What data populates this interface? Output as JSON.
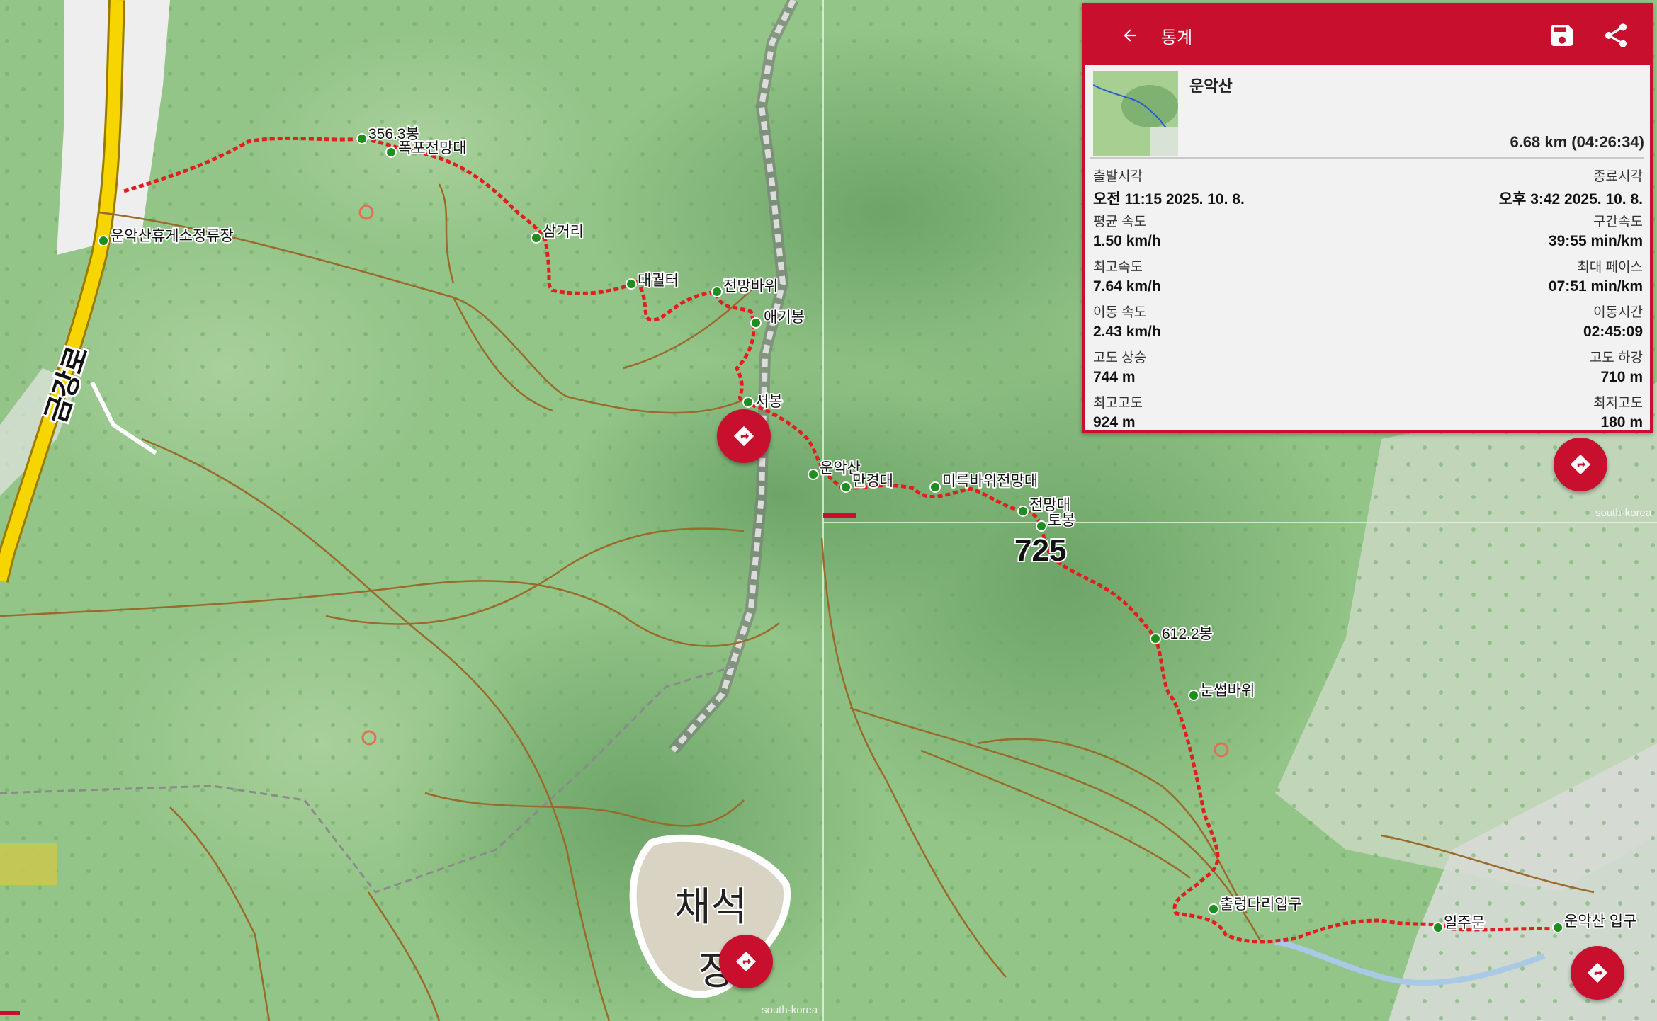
{
  "panel": {
    "title": "통계",
    "route_name": "운악산",
    "distance_time": "6.68 km (04:26:34)",
    "stats": [
      {
        "lk": "출발시각",
        "lv": "오전 11:15 2025. 10. 8.",
        "rk": "종료시각",
        "rv": "오후 3:42 2025. 10. 8."
      },
      {
        "lk": "평균 속도",
        "lv": "1.50 km/h",
        "rk": "구간속도",
        "rv": "39:55 min/km"
      },
      {
        "lk": "최고속도",
        "lv": "7.64 km/h",
        "rk": "최대 페이스",
        "rv": "07:51 min/km"
      },
      {
        "lk": "이동 속도",
        "lv": "2.43 km/h",
        "rk": "이동시간",
        "rv": "02:45:09"
      },
      {
        "lk": "고도 상승",
        "lv": "744 m",
        "rk": "고도 하강",
        "rv": "710 m"
      },
      {
        "lk": "최고고도",
        "lv": "924 m",
        "rk": "최저고도",
        "rv": "180 m"
      }
    ]
  },
  "map": {
    "waypoints": {
      "bong356": "356.3봉",
      "falls_view": "폭포전망대",
      "samgeori": "삼거리",
      "daegwolteo": "대궐터",
      "view_rock": "전망바위",
      "aegibong": "애기봉",
      "seobong": "서봉",
      "unaksan": "운악산",
      "mangyeongdae": "만경대",
      "mireuk": "미륵바위전망대",
      "view_point": "전망대",
      "tobong": "토봉",
      "bong612": "612.2봉",
      "nunsseop": "눈썹바위",
      "chulleong": "출렁다리입구",
      "iljumun": "일주문",
      "entrance": "운악산 입구",
      "rest_area": "운악산휴게소정류장"
    },
    "peak_elevation": "725",
    "road_name": "금강로",
    "area_name_1": "채석",
    "area_name_2": "장",
    "watermark": "south-korea",
    "colors": {
      "route": "#e02020",
      "accent": "#c8102e",
      "forest": "#8fbf84"
    }
  },
  "icons": {
    "back": "arrow-left-icon",
    "save": "save-icon",
    "share": "share-icon",
    "direction": "directions-icon"
  }
}
